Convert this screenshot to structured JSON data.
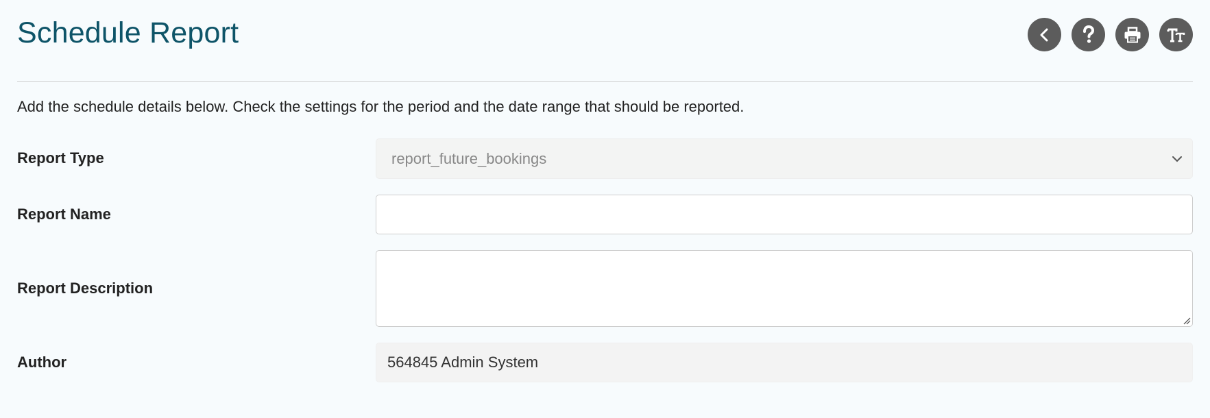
{
  "header": {
    "title": "Schedule Report",
    "toolbar": [
      {
        "name": "back",
        "icon": "chevron-left-icon"
      },
      {
        "name": "help",
        "icon": "question-icon"
      },
      {
        "name": "print",
        "icon": "printer-icon"
      },
      {
        "name": "text-size",
        "icon": "text-size-icon"
      }
    ]
  },
  "intro": "Add the schedule details below. Check the settings for the period and the date range that should be reported.",
  "form": {
    "report_type": {
      "label": "Report Type",
      "value": "report_future_bookings"
    },
    "report_name": {
      "label": "Report Name",
      "value": ""
    },
    "report_description": {
      "label": "Report Description",
      "value": ""
    },
    "author": {
      "label": "Author",
      "value": "564845 Admin System"
    }
  },
  "colors": {
    "title": "#0e5468",
    "toolbar_button": "#5c5c5c",
    "background": "#f7fbfd"
  }
}
